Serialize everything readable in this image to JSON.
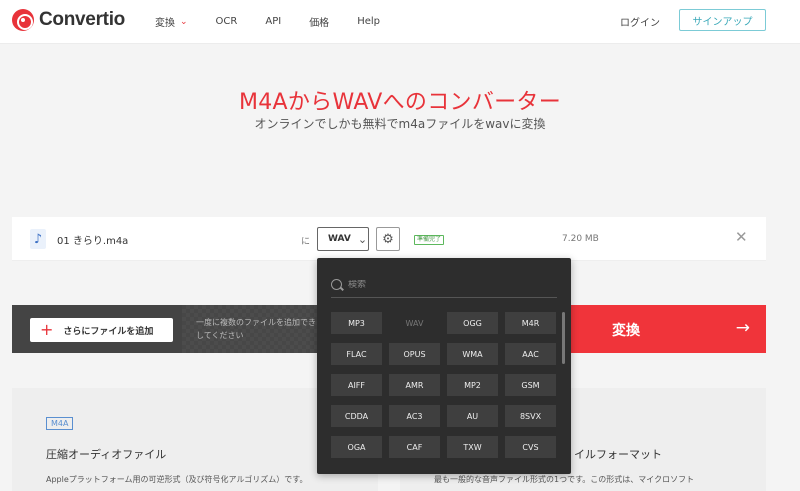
{
  "header": {
    "logo_text": "Convertio",
    "nav": [
      {
        "label": "変換"
      },
      {
        "label": "OCR"
      },
      {
        "label": "API"
      },
      {
        "label": "価格"
      },
      {
        "label": "Help"
      }
    ],
    "login_label": "ログイン",
    "signup_label": "サインアップ"
  },
  "hero": {
    "title": "M4AからWAVへのコンバーター",
    "subtitle": "オンラインでしかも無料でm4aファイルをwavに変換"
  },
  "file": {
    "name": "01 きらり.m4a",
    "to_label": "に",
    "target_format": "WAV",
    "status": "準備完了",
    "size": "7.20 MB"
  },
  "actions": {
    "add_files_label": "さらにファイルを追加",
    "hint": "一度に複数のファイルを追加できます してください",
    "convert_label": "変換"
  },
  "dropdown": {
    "search_placeholder": "検索",
    "formats": [
      "MP3",
      "WAV",
      "OGG",
      "M4R",
      "FLAC",
      "OPUS",
      "WMA",
      "AAC",
      "AIFF",
      "AMR",
      "MP2",
      "GSM",
      "CDDA",
      "AC3",
      "AU",
      "8SVX",
      "OGA",
      "CAF",
      "TXW",
      "CVS"
    ],
    "current": "WAV"
  },
  "info": {
    "left": {
      "badge": "M4A",
      "title": "圧縮オーディオファイル",
      "desc": "Appleプラットフォーム用の可逆形式（及び符号化アルゴリズム）です。"
    },
    "right": {
      "title": "イルフォーマット",
      "desc": "最も一般的な音声ファイル形式の1つです。この形式は、マイクロソフト"
    }
  },
  "colors": {
    "brand_red": "#e8333a",
    "signup_teal": "#3aa8b8",
    "dropdown_bg": "#2d2d2d"
  }
}
